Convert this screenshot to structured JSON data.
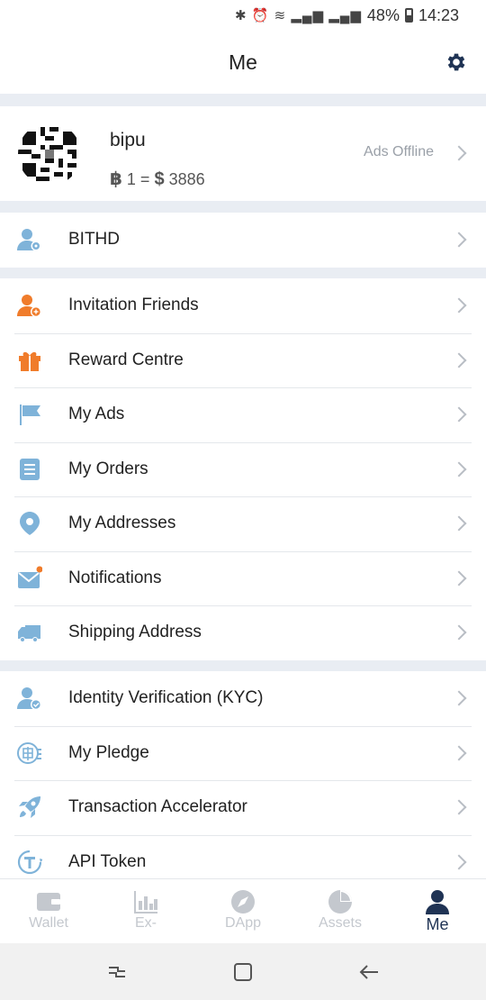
{
  "status_bar": {
    "icons": "✱ ⏰ ≋ ▂▄▆ ▂▄▆",
    "battery": "48%",
    "time": "14:23"
  },
  "header": {
    "title": "Me"
  },
  "profile": {
    "name": "bipu",
    "rate_prefix": "฿",
    "rate_middle": " 1 = ",
    "rate_currency": "$",
    "rate_value": " 3886",
    "ads_status": "Ads Offline"
  },
  "groups": [
    {
      "items": [
        {
          "label": "BITHD",
          "icon": "user-gear-icon"
        }
      ]
    },
    {
      "items": [
        {
          "label": "Invitation Friends",
          "icon": "user-add-icon"
        },
        {
          "label": "Reward Centre",
          "icon": "gift-icon"
        },
        {
          "label": "My Ads",
          "icon": "flag-icon"
        },
        {
          "label": "My Orders",
          "icon": "orders-icon"
        },
        {
          "label": "My Addresses",
          "icon": "location-pin-icon"
        },
        {
          "label": "Notifications",
          "icon": "envelope-icon"
        },
        {
          "label": "Shipping Address",
          "icon": "truck-icon"
        }
      ]
    },
    {
      "items": [
        {
          "label": "Identity Verification (KYC)",
          "icon": "user-check-icon"
        },
        {
          "label": "My Pledge",
          "icon": "pledge-icon"
        },
        {
          "label": "Transaction Accelerator",
          "icon": "rocket-icon"
        },
        {
          "label": "API Token",
          "icon": "token-icon"
        }
      ]
    }
  ],
  "tabbar": {
    "tabs": [
      {
        "label": "Wallet",
        "icon": "wallet-icon",
        "active": false
      },
      {
        "label": "Ex-",
        "icon": "exchange-chart-icon",
        "active": false
      },
      {
        "label": "DApp",
        "icon": "compass-icon",
        "active": false
      },
      {
        "label": "Assets",
        "icon": "pie-chart-icon",
        "active": false
      },
      {
        "label": "Me",
        "icon": "person-icon",
        "active": true
      }
    ]
  },
  "colors": {
    "accent": "#1f3354",
    "icon_blue": "#7fb3d9",
    "icon_orange": "#f07c2b",
    "divider": "#e9edf3",
    "chevron": "#b8bdc4"
  }
}
